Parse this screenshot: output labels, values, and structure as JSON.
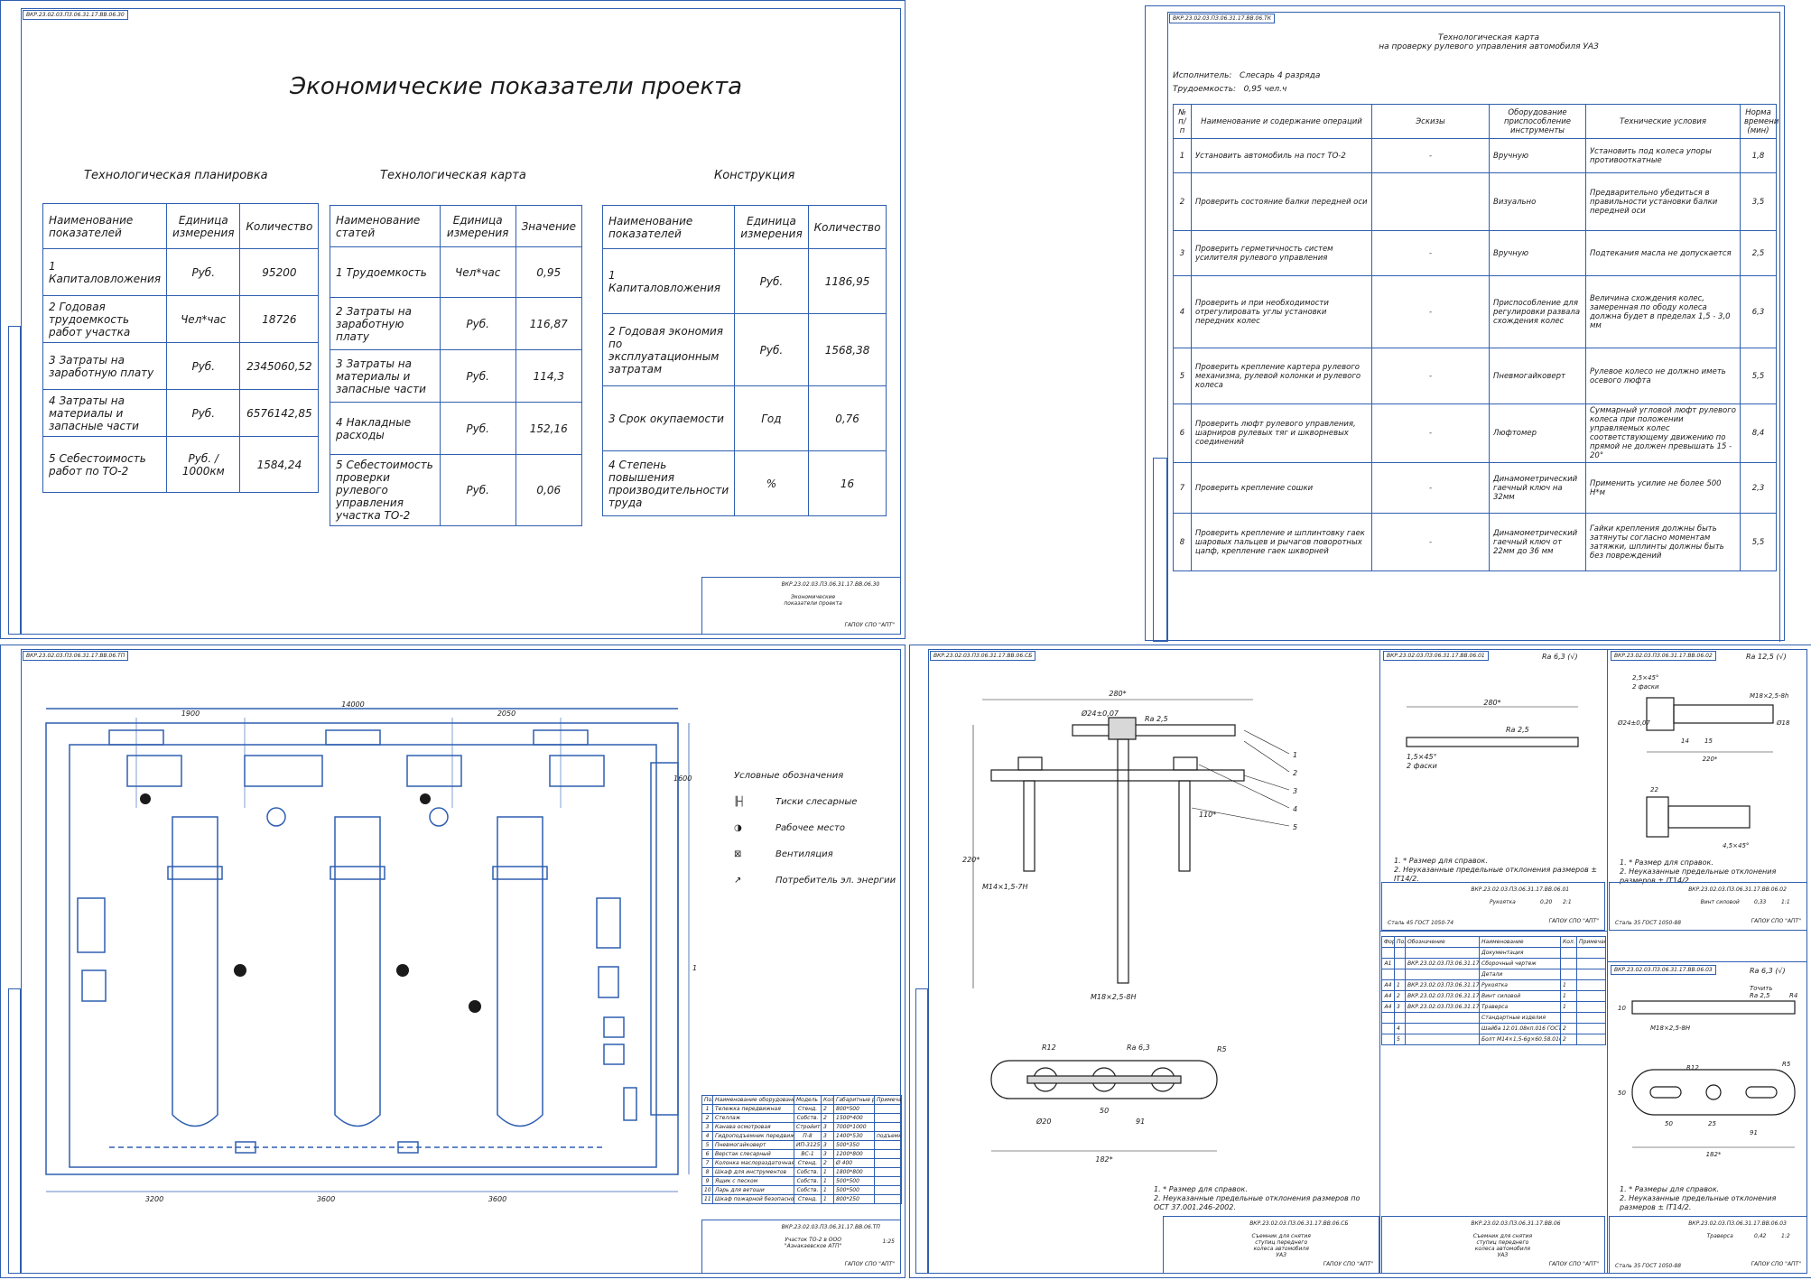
{
  "economic": {
    "code": "ВКР.23.02.03.ПЗ.06.31.17.ВВ.06.30",
    "title": "Экономические показатели проекта",
    "tables": [
      {
        "section": "Технологическая планировка",
        "headers": [
          "Наименование показателей",
          "Единица измерения",
          "Количество"
        ],
        "rows": [
          [
            "1 Капиталовложения",
            "Руб.",
            "95200"
          ],
          [
            "2 Годовая трудоемкость работ участка",
            "Чел*час",
            "18726"
          ],
          [
            "3 Затраты на заработную плату",
            "Руб.",
            "2345060,52"
          ],
          [
            "4 Затраты на материалы и запасные части",
            "Руб.",
            "6576142,85"
          ],
          [
            "5 Себестоимость работ по ТО-2",
            "Руб. / 1000км",
            "1584,24"
          ]
        ]
      },
      {
        "section": "Технологическая карта",
        "headers": [
          "Наименование статей",
          "Единица измерения",
          "Значение"
        ],
        "rows": [
          [
            "1 Трудоемкость",
            "Чел*час",
            "0,95"
          ],
          [
            "2 Затраты на заработную плату",
            "Руб.",
            "116,87"
          ],
          [
            "3 Затраты на материалы и запасные части",
            "Руб.",
            "114,3"
          ],
          [
            "4 Накладные расходы",
            "Руб.",
            "152,16"
          ],
          [
            "5 Себестоимость проверки рулевого управления участка ТО-2",
            "Руб.",
            "0,06"
          ]
        ]
      },
      {
        "section": "Конструкция",
        "headers": [
          "Наименование показателей",
          "Единица измерения",
          "Количество"
        ],
        "rows": [
          [
            "1 Капиталовложения",
            "Руб.",
            "1186,95"
          ],
          [
            "2 Годовая экономия по эксплуатационным затратам",
            "Руб.",
            "1568,38"
          ],
          [
            "3 Срок окупаемости",
            "Год",
            "0,76"
          ],
          [
            "4 Степень повышения производительности труда",
            "%",
            "16"
          ]
        ]
      }
    ],
    "stamp": {
      "designation": "ВКР.23.02.03.ПЗ.06.31.17.ВВ.06.30",
      "name": "Экономические показатели проекта",
      "org": "ГАПОУ СПО \"АПТ\""
    }
  },
  "techcard": {
    "code": "ВКР.23.02.03.ПЗ.06.31.17.ВВ.06.ТК",
    "title_line1": "Технологическая карта",
    "title_line2": "на проверку рулевого управления автомобиля УАЗ",
    "executor_label": "Исполнитель:",
    "executor_value": "Слесарь 4 разряда",
    "labor_label": "Трудоемкость:",
    "labor_value": "0,95 чел.ч",
    "headers": [
      "№ п/п",
      "Наименование и содержание операций",
      "Эскизы",
      "Оборудование приспособление инструменты",
      "Технические условия",
      "Норма времени (мин)"
    ],
    "rows": [
      [
        "1",
        "Установить автомобиль на пост ТО-2",
        "-",
        "Вручную",
        "Установить под колеса упоры противооткатные",
        "1,8"
      ],
      [
        "2",
        "Проверить состояние балки передней оси",
        "",
        "Визуально",
        "Предварительно убедиться в правильности установки балки передней оси",
        "3,5"
      ],
      [
        "3",
        "Проверить герметичность систем усилителя рулевого управления",
        "-",
        "Вручную",
        "Подтекания масла не допускается",
        "2,5"
      ],
      [
        "4",
        "Проверить и при необходимости отрегулировать углы установки передних колес",
        "-",
        "Приспособление для регулировки развала схождения колес",
        "Величина схождения колес, замеренная по ободу колеса должна будет в пределах 1,5 - 3,0 мм",
        "6,3"
      ],
      [
        "5",
        "Проверить крепление картера рулевого механизма, рулевой колонки и рулевого колеса",
        "-",
        "Пневмогайковерт",
        "Рулевое колесо не должно иметь осевого люфта",
        "5,5"
      ],
      [
        "6",
        "Проверить люфт рулевого управления, шарниров рулевых тяг и шкворневых соединений",
        "-",
        "Люфтомер",
        "Суммарный угловой люфт рулевого колеса при положении управляемых колес соответствующему движению по прямой не должен превышать 15 - 20°",
        "8,4"
      ],
      [
        "7",
        "Проверить крепление сошки",
        "-",
        "Динамометрический гаечный ключ на 32мм",
        "Применить усилие не более 500 Н*м",
        "2,3"
      ],
      [
        "8",
        "Проверить крепление и шплинтовку гаек шаровых пальцев и рычагов поворотных цапф, крепление гаек шкворней",
        "-",
        "Динамометрический гаечный ключ от 22мм до 36 мм",
        "Гайки крепления должны быть затянуты согласно моментам затяжки, шплинты должны быть без повреждений",
        "5,5"
      ]
    ]
  },
  "layout_sheet": {
    "code": "ВКР.23.02.03.ПЗ.06.31.17.ВВ.06.ТП",
    "dims": {
      "total": "14000",
      "d1": "1900",
      "d2": "2050",
      "d3": "1600",
      "height": "10000",
      "b1": "3200",
      "b2": "3600",
      "b3": "3600"
    },
    "legend_title": "Условные обозначения",
    "legend": [
      "Тиски слесарные",
      "Рабочее место",
      "Вентиляция",
      "Потребитель эл. энергии"
    ],
    "equipment_headers": [
      "Поз.",
      "Наименование оборудования",
      "Модель",
      "Кол.",
      "Габаритные размеры мм",
      "Примечание"
    ],
    "equipment": [
      [
        "1",
        "Тележка передвижная",
        "Стенд.",
        "2",
        "800*500",
        ""
      ],
      [
        "2",
        "Стеллаж",
        "Собств.",
        "2",
        "1500*400",
        ""
      ],
      [
        "3",
        "Канава осмотровая",
        "Стройит.",
        "3",
        "7000*1000",
        ""
      ],
      [
        "4",
        "Гидроподъемник передвижной",
        "П-8",
        "3",
        "1400*530",
        "подъемник"
      ],
      [
        "5",
        "Пневмогайковерт",
        "ИП-3125",
        "3",
        "500*350",
        ""
      ],
      [
        "6",
        "Верстак слесарный",
        "ВС-1",
        "3",
        "1200*800",
        ""
      ],
      [
        "7",
        "Колонка маслораздаточная",
        "Стенд.",
        "2",
        "Ø 400",
        ""
      ],
      [
        "8",
        "Шкаф для инструментов",
        "Собств.",
        "1",
        "1800*800",
        ""
      ],
      [
        "9",
        "Ящик с песком",
        "Собств.",
        "1",
        "500*500",
        ""
      ],
      [
        "10",
        "Ларь для ветоши",
        "Собств.",
        "1",
        "500*500",
        ""
      ],
      [
        "11",
        "Шкаф пожарной безопасности",
        "Стенд.",
        "1",
        "800*250",
        ""
      ]
    ],
    "stamp": {
      "designation": "ВКР.23.02.03.ПЗ.06.31.17.ВВ.06.ТП",
      "name": "Участок ТО-2 в ООО \"Азнакаевское АТП\"",
      "scale": "1:25",
      "org": "ГАПОУ СПО \"АПТ\""
    }
  },
  "assembly": {
    "code": "ВКР.23.02.03.ПЗ.06.31.17.ВВ.06.СБ",
    "positions": [
      "1",
      "2",
      "3",
      "4",
      "5"
    ],
    "dims": {
      "width": "280*",
      "height": "220*",
      "base": "182*",
      "span": "91",
      "gap": "50",
      "rad1": "R12",
      "rad2": "R5",
      "rough": "Ra 2,5",
      "rough2": "Ra 6,3",
      "thread1": "М14×1,5-7Н",
      "thread2": "М18×2,5-8Н",
      "d1": "Ø24±0,07",
      "d2": "Ø20",
      "l1": "110*"
    },
    "notes": [
      "1. * Размер для справок.",
      "2. Неуказанные предельные отклонения размеров по ОСТ 37.001.246-2002."
    ],
    "stamp": {
      "designation": "ВКР.23.02.03.ПЗ.06.31.17.ВВ.06.СБ",
      "name": "Съемник для снятия ступиц переднего колеса автомобиля УАЗ",
      "org": "ГАПОУ СПО \"АПТ\""
    }
  },
  "handle": {
    "code": "ВКР.23.02.03.ПЗ.06.31.17.ВВ.06.01",
    "rough": "Ra 6,3 (√)",
    "length": "280*",
    "rough_inner": "Ra 2,5",
    "chamfer": "1,5×45°",
    "chamfer_note": "2 фаски",
    "notes": [
      "1. * Размер для справок.",
      "2. Неуказанные предельные отклонения размеров ± IT14/2."
    ],
    "name": "Рукоятка",
    "mass": "0,20",
    "scale": "2:1",
    "material": "Сталь 45 ГОСТ 1050-74",
    "org": "ГАПОУ СПО \"АПТ\""
  },
  "screw": {
    "code": "ВКР.23.02.03.ПЗ.06.31.17.ВВ.06.02",
    "rough": "Ra 12,5 (√)",
    "chamfer": "2,5×45°",
    "chamfer_note": "2 фаски",
    "dims": {
      "length": "220*",
      "a": "15",
      "b": "14",
      "dia1": "Ø24±0,07",
      "dia2": "Ø18",
      "thread": "М18×2,5-8h",
      "c": "22",
      "chamfer2": "4,5×45°"
    },
    "notes": [
      "1. * Размер для справок.",
      "2. Неуказанные предельные отклонения размеров ± IT14/2."
    ],
    "name": "Винт силовой",
    "mass": "0,33",
    "scale": "1:1",
    "material": "Сталь 35 ГОСТ 1050-88",
    "org": "ГАПОУ СПО \"АПТ\""
  },
  "spec": {
    "code": "ВКР.23.02.03.ПЗ.06.31.17.ВВ.06",
    "headers": [
      "Формат",
      "Поз.",
      "Обозначение",
      "Наименование",
      "Кол.",
      "Примечание"
    ],
    "rows": [
      [
        "",
        "",
        "",
        "Документация",
        "",
        ""
      ],
      [
        "А1",
        "",
        "ВКР.23.02.03.ПЗ.06.31.17.ВВ.06.СБ",
        "Сборочный чертеж",
        "",
        ""
      ],
      [
        "",
        "",
        "",
        "Детали",
        "",
        ""
      ],
      [
        "А4",
        "1",
        "ВКР.23.02.03.ПЗ.06.31.17.ВВ.06.01",
        "Рукоятка",
        "1",
        ""
      ],
      [
        "А4",
        "2",
        "ВКР.23.02.03.ПЗ.06.31.17.ВВ.06.02",
        "Винт силовой",
        "1",
        ""
      ],
      [
        "А4",
        "3",
        "ВКР.23.02.03.ПЗ.06.31.17.ВВ.06.03",
        "Траверса",
        "1",
        ""
      ],
      [
        "",
        "",
        "",
        "Стандартные изделия",
        "",
        ""
      ],
      [
        "",
        "4",
        "",
        "Шайба 12.01.08кп.016 ГОСТ 11371-78",
        "2",
        ""
      ],
      [
        "",
        "5",
        "",
        "Болт М14×1,5-6g×60.58.016 ГОСТ 7808-70",
        "2",
        ""
      ]
    ],
    "stamp": {
      "designation": "ВКР.23.02.03.ПЗ.06.31.17.ВВ.06",
      "name": "Съемник для снятия ступиц переднего колеса автомобиля УАЗ",
      "org": "ГАПОУ СПО \"АПТ\""
    }
  },
  "traverse": {
    "code": "ВКР.23.02.03.ПЗ.06.31.17.ВВ.06.03",
    "rough": "Ra 6,3 (√)",
    "dims": {
      "length": "182*",
      "span": "91",
      "a": "50",
      "b": "25",
      "r": "R12",
      "r2": "R5",
      "thread": "М18×2,5-8Н",
      "h": "10",
      "w": "50",
      "turn": "Точить",
      "ra": "Ra 2,5",
      "ch": "R4"
    },
    "notes": [
      "1. * Размеры для справок.",
      "2. Неуказанные предельные отклонения размеров ± IT14/2."
    ],
    "name": "Траверса",
    "mass": "0,42",
    "scale": "1:2",
    "material": "Сталь 35 ГОСТ 1050-88",
    "org": "ГАПОУ СПО \"АПТ\""
  },
  "colors": {
    "frame": "#2f5fb0",
    "ink": "#1a1a1a"
  }
}
